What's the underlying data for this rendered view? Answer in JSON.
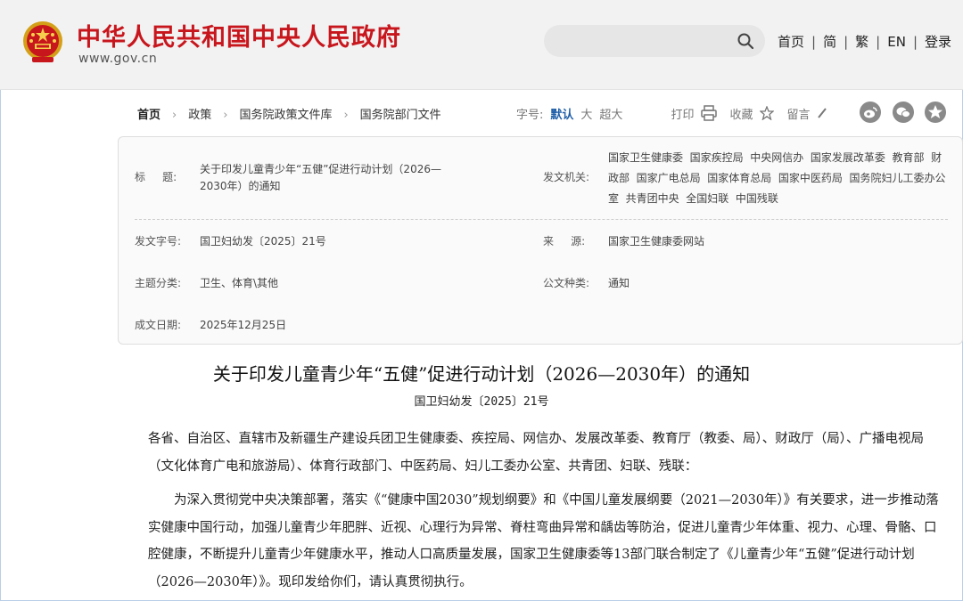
{
  "header": {
    "site_title": "中华人民共和国中央人民政府",
    "site_url": "www.gov.cn",
    "search_placeholder": "",
    "links": [
      "首页",
      "简",
      "繁",
      "EN",
      "登录"
    ],
    "colors": {
      "brand_red": "#c8161d",
      "link_blue": "#1f5fa8"
    }
  },
  "breadcrumb": {
    "items": [
      "首页",
      "政策",
      "国务院政策文件库",
      "国务院部门文件"
    ]
  },
  "toolbar": {
    "font_size_label": "字号:",
    "font_default": "默认",
    "font_large": "大",
    "font_xlarge": "超大",
    "print": "打印",
    "favorite": "收藏",
    "comment": "留言",
    "icons": [
      "printer-icon",
      "star-icon",
      "pencil-icon",
      "weibo-icon",
      "wechat-icon",
      "qzone-icon"
    ]
  },
  "info": {
    "title_label": "标     题:",
    "title_value": "关于印发儿童青少年“五健”促进行动计划（2026—2030年）的通知",
    "issuer_label": "发文机关:",
    "issuer_value": "国家卫生健康委  国家疾控局  中央网信办  国家发展改革委  教育部  财政部  国家广电总局  国家体育总局  国家中医药局  国务院妇儿工委办公室  共青团中央  全国妇联  中国残联",
    "docno_label": "发文字号:",
    "docno_value": "国卫妇幼发〔2025〕21号",
    "source_label": "来     源:",
    "source_value": "国家卫生健康委网站",
    "topic_label": "主题分类:",
    "topic_value": "卫生、体育\\其他",
    "type_label": "公文种类:",
    "type_value": "通知",
    "date_label": "成文日期:",
    "date_value": "2025年12月25日"
  },
  "article": {
    "title": "关于印发儿童青少年“五健”促进行动计划（2026—2030年）的通知",
    "doc_no": "国卫妇幼发〔2025〕21号",
    "p1": "各省、自治区、直辖市及新疆生产建设兵团卫生健康委、疾控局、网信办、发展改革委、教育厅（教委、局）、财政厅（局）、广播电视局（文化体育广电和旅游局）、体育行政部门、中医药局、妇儿工委办公室、共青团、妇联、残联：",
    "p2": "为深入贯彻党中央决策部署，落实《“健康中国2030”规划纲要》和《中国儿童发展纲要（2021—2030年）》有关要求，进一步推动落实健康中国行动，加强儿童青少年肥胖、近视、心理行为异常、脊柱弯曲异常和龋齿等防治，促进儿童青少年体重、视力、心理、骨骼、口腔健康，不断提升儿童青少年健康水平，推动人口高质量发展，国家卫生健康委等13部门联合制定了《儿童青少年“五健”促进行动计划（2026—2030年）》。现印发给你们，请认真贯彻执行。"
  }
}
